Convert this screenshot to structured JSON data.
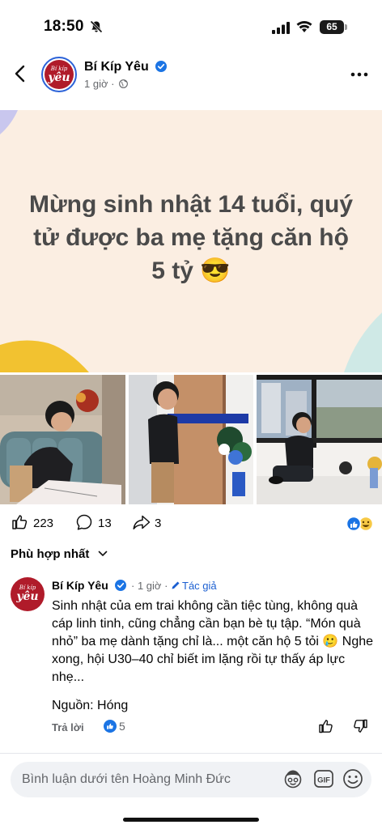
{
  "status_bar": {
    "time": "18:50",
    "battery": "65"
  },
  "post": {
    "page_name": "Bí Kíp Yêu",
    "time": "1 giờ",
    "avatar_text_top": "Bí kíp",
    "avatar_text_bottom": "yêu",
    "hero_title": "Mừng sinh nhật 14 tuổi, quý tử được ba mẹ tặng căn hộ 5 tỷ 😎"
  },
  "reactions": {
    "likes": "223",
    "comments": "13",
    "shares": "3"
  },
  "sort": {
    "label": "Phù hợp nhất"
  },
  "comment": {
    "author": "Bí Kíp Yêu",
    "time": "1 giờ",
    "author_tag": "Tác giả",
    "body": "Sinh nhật của em trai không cần tiệc tùng, không quà cáp linh tinh, cũng chẳng cần bạn bè tụ tập. “Món quà nhỏ” ba mẹ dành tặng chỉ là... một căn hộ 5 tỏi 🥲 Nghe xong, hội U30–40 chỉ biết im lặng rồi tự thấy áp lực nhẹ...",
    "source": "Nguồn: Hóng",
    "reply_label": "Trả lời",
    "like_count": "5"
  },
  "composer": {
    "placeholder": "Bình luận dưới tên Hoàng Minh Đức"
  },
  "colors": {
    "accent": "#1b74e4",
    "brand_red": "#b01b2a",
    "hero_bg": "#fbeee2"
  }
}
